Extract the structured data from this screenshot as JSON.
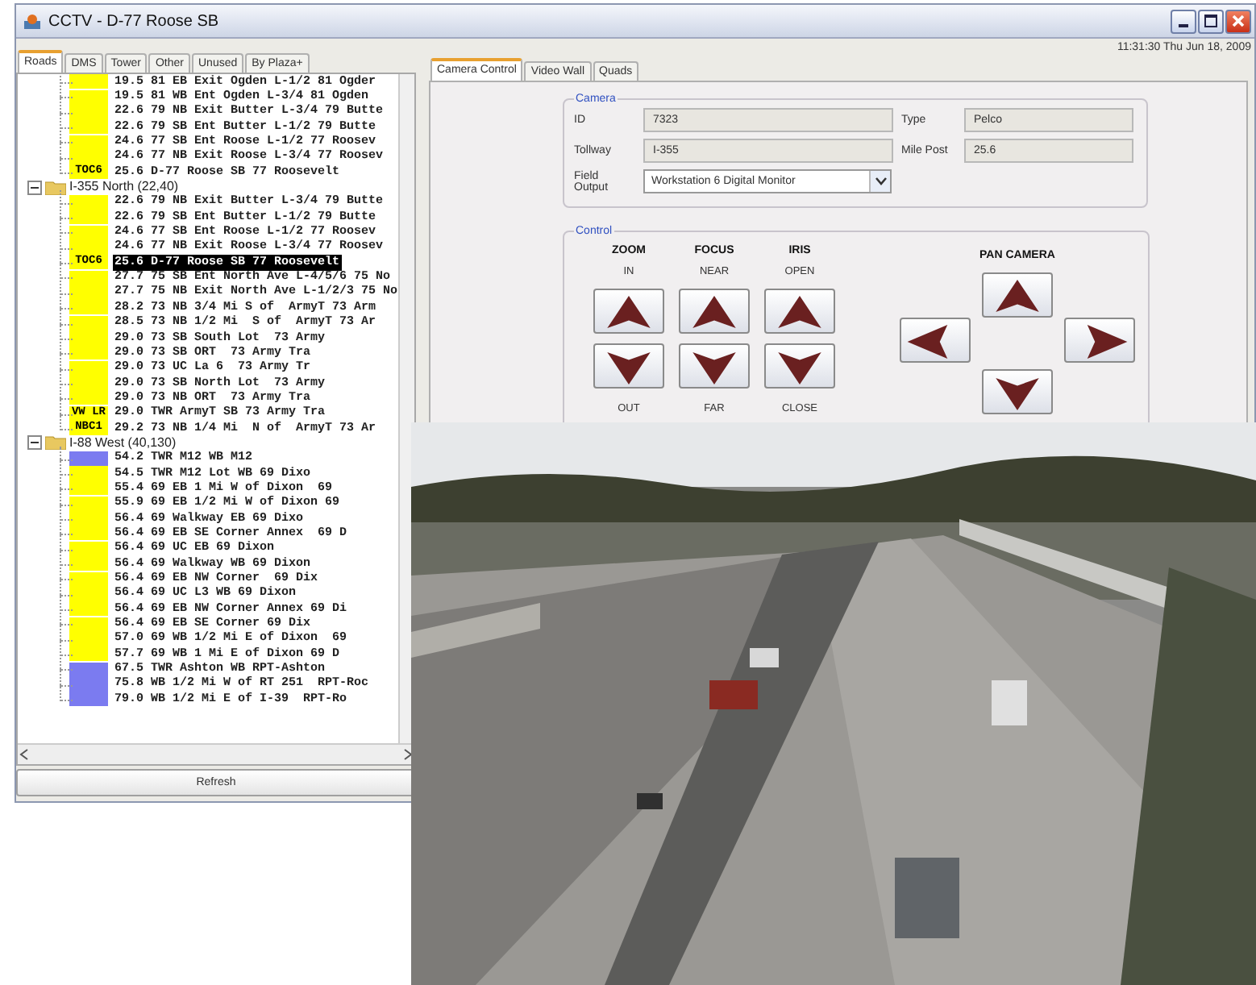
{
  "window": {
    "title": "CCTV - D-77 Roose SB",
    "clock": "11:31:30 Thu Jun 18, 2009"
  },
  "left_tabs": [
    {
      "label": "Roads",
      "selected": true
    },
    {
      "label": "DMS",
      "selected": false
    },
    {
      "label": "Tower",
      "selected": false
    },
    {
      "label": "Other",
      "selected": false
    },
    {
      "label": "Unused",
      "selected": false
    },
    {
      "label": "By Plaza+",
      "selected": false
    }
  ],
  "tree": [
    {
      "kind": "group",
      "children": [
        {
          "label": "19.5 81 EB Exit Ogden L-1/2 81 Ogder",
          "color": "#ffff00",
          "selected": false
        },
        {
          "label": "19.5 81 WB Ent Ogden L-3/4 81 Ogden",
          "color": "#ffff00",
          "selected": false
        },
        {
          "label": "22.6 79 NB Exit Butter L-3/4 79 Butte",
          "color": "#ffff00",
          "selected": false
        },
        {
          "label": "22.6 79 SB Ent Butter L-1/2 79 Butte",
          "color": "#ffff00",
          "selected": false
        },
        {
          "label": "24.6 77 SB Ent Roose L-1/2 77 Roosev",
          "color": "#ffff00",
          "selected": false
        },
        {
          "label": "24.6 77 NB Exit Roose L-3/4 77 Roosev",
          "color": "#ffff00",
          "selected": false
        },
        {
          "label": "25.6 D-77 Roose SB 77 Roosevelt",
          "badge": "TOC6",
          "color": "#ffff00",
          "selected": false
        }
      ]
    },
    {
      "kind": "group",
      "label": "I-355 North (22,40)",
      "expanded": true,
      "children": [
        {
          "label": "22.6 79 NB Exit Butter L-3/4 79 Butte",
          "color": "#ffff00",
          "selected": false
        },
        {
          "label": "22.6 79 SB Ent Butter L-1/2 79 Butte",
          "color": "#ffff00",
          "selected": false
        },
        {
          "label": "24.6 77 SB Ent Roose L-1/2 77 Roosev",
          "color": "#ffff00",
          "selected": false
        },
        {
          "label": "24.6 77 NB Exit Roose L-3/4 77 Roosev",
          "color": "#ffff00",
          "selected": false
        },
        {
          "label": "25.6 D-77 Roose SB 77 Roosevelt",
          "badge": "TOC6",
          "color": "#ffff00",
          "selected": true
        },
        {
          "label": "27.7 75 SB Ent North Ave L-4/5/6 75 No",
          "color": "#ffff00",
          "selected": false
        },
        {
          "label": "27.7 75 NB Exit North Ave L-1/2/3 75 No",
          "color": "#ffff00",
          "selected": false
        },
        {
          "label": "28.2 73 NB 3/4 Mi S of  ArmyT 73 Arm",
          "color": "#ffff00",
          "selected": false
        },
        {
          "label": "28.5 73 NB 1/2 Mi  S of  ArmyT 73 Ar",
          "color": "#ffff00",
          "selected": false
        },
        {
          "label": "29.0 73 SB South Lot  73 Army",
          "color": "#ffff00",
          "selected": false
        },
        {
          "label": "29.0 73 SB ORT  73 Army Tra",
          "color": "#ffff00",
          "selected": false
        },
        {
          "label": "29.0 73 UC La 6  73 Army Tr",
          "color": "#ffff00",
          "selected": false
        },
        {
          "label": "29.0 73 SB North Lot  73 Army",
          "color": "#ffff00",
          "selected": false
        },
        {
          "label": "29.0 73 NB ORT  73 Army Tra",
          "color": "#ffff00",
          "selected": false
        },
        {
          "label": "29.0 TWR ArmyT SB 73 Army Tra",
          "badge": "VW LR",
          "color": "#ffff00",
          "selected": false
        },
        {
          "label": "29.2 73 NB 1/4 Mi  N of  ArmyT 73 Ar",
          "badge": "NBC1",
          "color": "#ffff00",
          "selected": false
        }
      ]
    },
    {
      "kind": "group",
      "label": "I-88 West (40,130)",
      "expanded": true,
      "children": [
        {
          "label": "54.2 TWR M12 WB M12",
          "color": "#7b7bf0",
          "selected": false
        },
        {
          "label": "54.5 TWR M12 Lot WB 69 Dixo",
          "color": "#ffff00",
          "selected": false
        },
        {
          "label": "55.4 69 EB 1 Mi W of Dixon  69",
          "color": "#ffff00",
          "selected": false
        },
        {
          "label": "55.9 69 EB 1/2 Mi W of Dixon 69",
          "color": "#ffff00",
          "selected": false
        },
        {
          "label": "56.4 69 Walkway EB 69 Dixo",
          "color": "#ffff00",
          "selected": false
        },
        {
          "label": "56.4 69 EB SE Corner Annex  69 D",
          "color": "#ffff00",
          "selected": false
        },
        {
          "label": "56.4 69 UC EB 69 Dixon",
          "color": "#ffff00",
          "selected": false
        },
        {
          "label": "56.4 69 Walkway WB 69 Dixon",
          "color": "#ffff00",
          "selected": false
        },
        {
          "label": "56.4 69 EB NW Corner  69 Dix",
          "color": "#ffff00",
          "selected": false
        },
        {
          "label": "56.4 69 UC L3 WB 69 Dixon",
          "color": "#ffff00",
          "selected": false
        },
        {
          "label": "56.4 69 EB NW Corner Annex 69 Di",
          "color": "#ffff00",
          "selected": false
        },
        {
          "label": "56.4 69 EB SE Corner 69 Dix",
          "color": "#ffff00",
          "selected": false
        },
        {
          "label": "57.0 69 WB 1/2 Mi E of Dixon  69",
          "color": "#ffff00",
          "selected": false
        },
        {
          "label": "57.7 69 WB 1 Mi E of Dixon 69 D",
          "color": "#ffff00",
          "selected": false
        },
        {
          "label": "67.5 TWR Ashton WB RPT-Ashton",
          "color": "#7b7bf0",
          "selected": false
        },
        {
          "label": "75.8 WB 1/2 Mi W of RT 251  RPT-Roc",
          "color": "#7b7bf0",
          "selected": false
        },
        {
          "label": "79.0 WB 1/2 Mi E of I-39  RPT-Ro",
          "color": "#7b7bf0",
          "selected": false
        }
      ]
    }
  ],
  "refresh_button": "Refresh",
  "right_tabs": [
    {
      "label": "Camera Control",
      "selected": true
    },
    {
      "label": "Video Wall",
      "selected": false
    },
    {
      "label": "Quads",
      "selected": false
    }
  ],
  "camera": {
    "legend": "Camera",
    "fields": [
      {
        "label": "ID",
        "value": "7323"
      },
      {
        "label": "Type",
        "value": "Pelco"
      },
      {
        "label": "Tollway",
        "value": "I-355"
      },
      {
        "label": "Mile Post",
        "value": "25.6"
      }
    ],
    "field_output": {
      "label": "Field Output",
      "value": "Workstation 6 Digital Monitor"
    }
  },
  "control": {
    "legend": "Control",
    "columns": [
      {
        "title": "ZOOM",
        "up": "IN",
        "down": "OUT"
      },
      {
        "title": "FOCUS",
        "up": "NEAR",
        "down": "FAR"
      },
      {
        "title": "IRIS",
        "up": "OPEN",
        "down": "CLOSE"
      }
    ],
    "pan_title": "PAN CAMERA"
  }
}
